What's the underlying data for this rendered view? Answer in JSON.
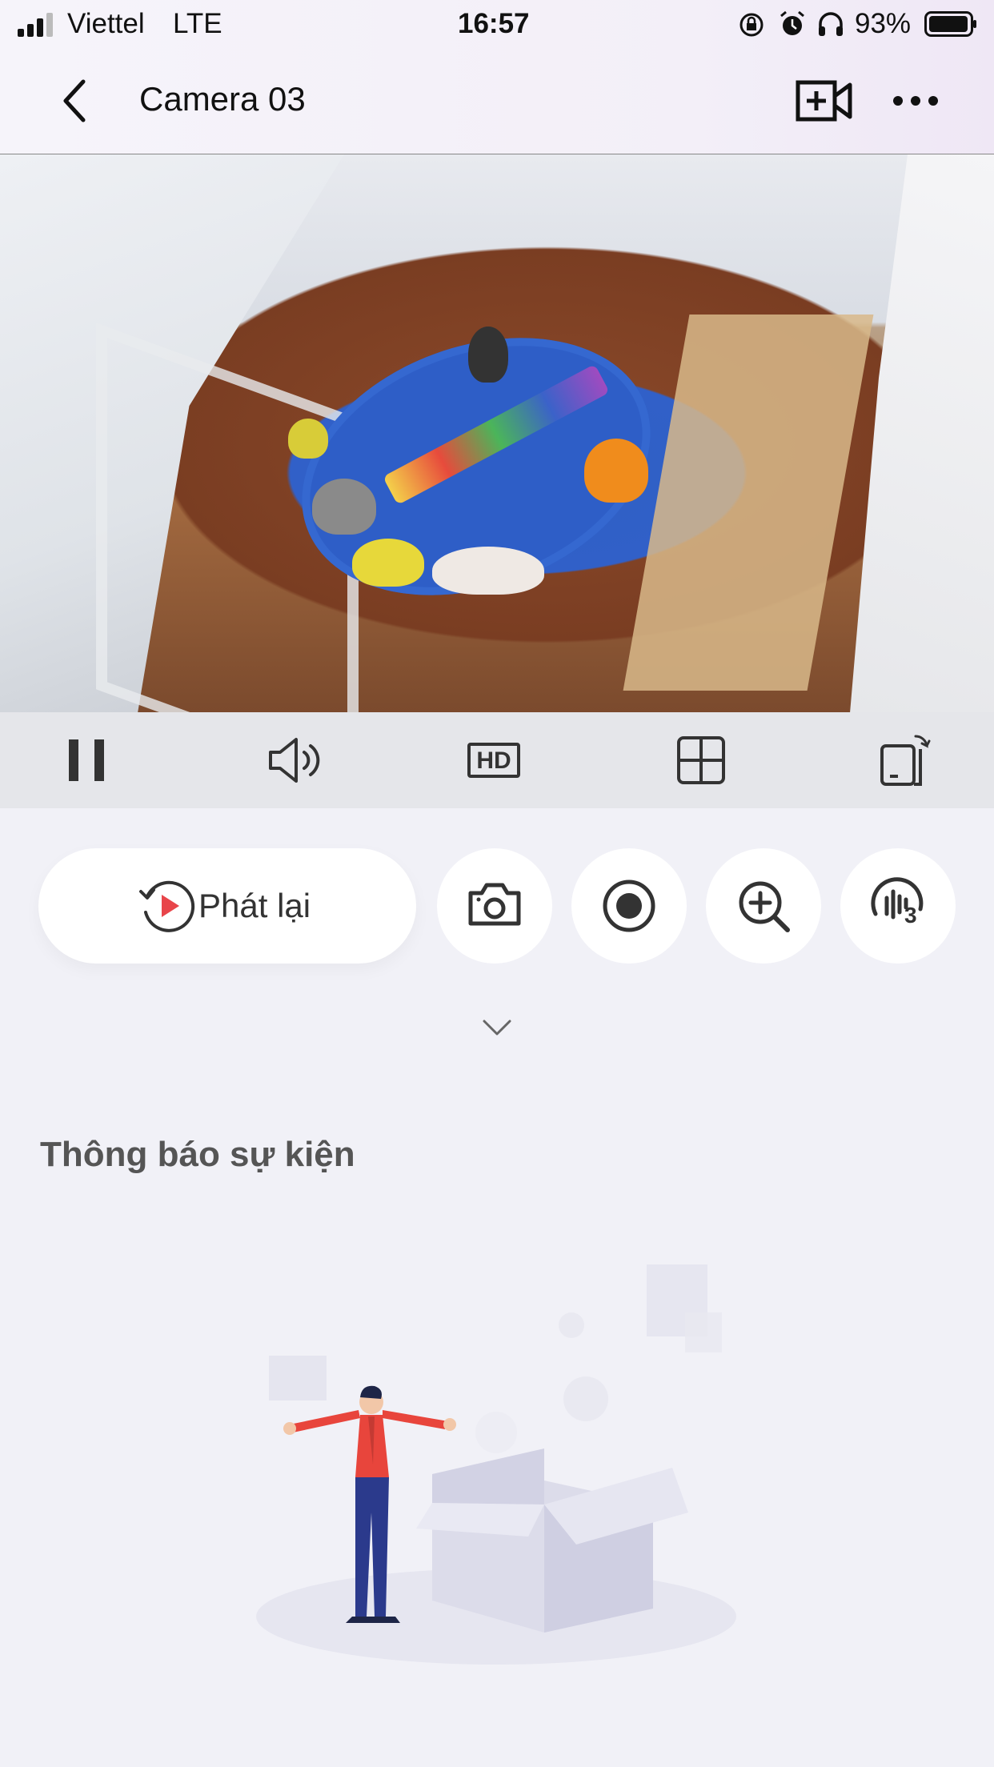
{
  "status_bar": {
    "carrier": "Viettel",
    "network": "LTE",
    "time": "16:57",
    "battery": "93%",
    "icons": [
      "rotation-lock-icon",
      "alarm-icon",
      "headphones-icon",
      "battery-icon"
    ]
  },
  "header": {
    "title": "Camera 03",
    "icons": [
      "back-icon",
      "add-video-icon",
      "more-icon"
    ]
  },
  "player_controls": {
    "icons": [
      "pause-icon",
      "volume-icon",
      "hd-icon",
      "grid-icon",
      "rotate-device-icon"
    ],
    "hd_label": "HD"
  },
  "actions": {
    "playback_label": "Phát lại",
    "icons": [
      "playback-icon",
      "snapshot-icon",
      "record-icon",
      "zoom-in-icon",
      "voice-icon"
    ],
    "voice_badge": "3"
  },
  "events": {
    "section_title": "Thông báo sự kiện"
  },
  "colors": {
    "background": "#f1f1f7",
    "accent_red": "#e8454a",
    "illustration_jacket": "#e8453c",
    "illustration_trousers": "#2b3a8c"
  }
}
